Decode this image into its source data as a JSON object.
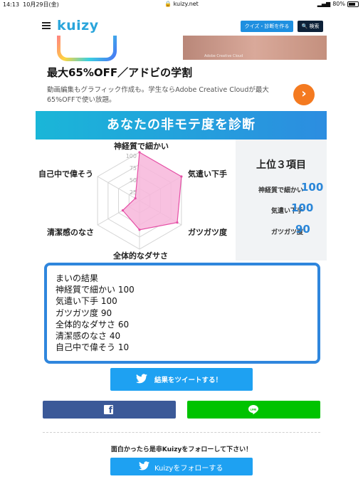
{
  "status_bar": {
    "time": "14:13",
    "date": "10月29日(金)",
    "url": "kuizy.net",
    "battery": "80%"
  },
  "header": {
    "logo": "kuizy",
    "create_label": "クイズ・診断を作る",
    "search_label": "検索"
  },
  "ad": {
    "photo_caption": "Adobe Creative Cloud",
    "title": "最大65%OFF／アドビの学割",
    "body": "動画編集もグラフィック作成も。学生ならAdobe Creative Cloudが最大65%OFFで使い放題。",
    "arrow": "›"
  },
  "banner": {
    "title": "あなたの非モテ度を診断"
  },
  "chart_data": {
    "type": "radar",
    "axes": [
      "神経質で細かい",
      "気遣い下手",
      "ガツガツ度",
      "全体的なダサさ",
      "清潔感のなさ",
      "自己中で偉そう"
    ],
    "values": [
      100,
      100,
      90,
      60,
      40,
      10
    ],
    "ticks": [
      "100",
      "75",
      "50",
      "25"
    ],
    "range": [
      0,
      100
    ],
    "fill_color": "#f7b6da",
    "line_color": "#e64fa6"
  },
  "top3": {
    "title": "上位３項目",
    "items": [
      {
        "name": "神経質で細かい",
        "value": "100"
      },
      {
        "name": "気遣い下手",
        "value": "100"
      },
      {
        "name": "ガツガツ度",
        "value": "90"
      }
    ]
  },
  "result": {
    "lines": [
      "まいの結果",
      "神経質で細かい 100",
      "気遣い下手 100",
      "ガツガツ度 90",
      "全体的なダサさ 60",
      "清潔感のなさ 40",
      "自己中で偉そう 10"
    ]
  },
  "share": {
    "tweet_label": "結果をツイートする！",
    "facebook_icon": "facebook-icon",
    "line_icon": "line-icon"
  },
  "follow": {
    "message": "面白かったら是非Kuizyをフォローして下さい！",
    "button_label": "Kuizyをフォローする"
  },
  "colors": {
    "accent": "#2aa5db",
    "twitter": "#1ea1f2",
    "facebook": "#3b5998",
    "line": "#00c300",
    "value_blue": "#2a86d8"
  }
}
